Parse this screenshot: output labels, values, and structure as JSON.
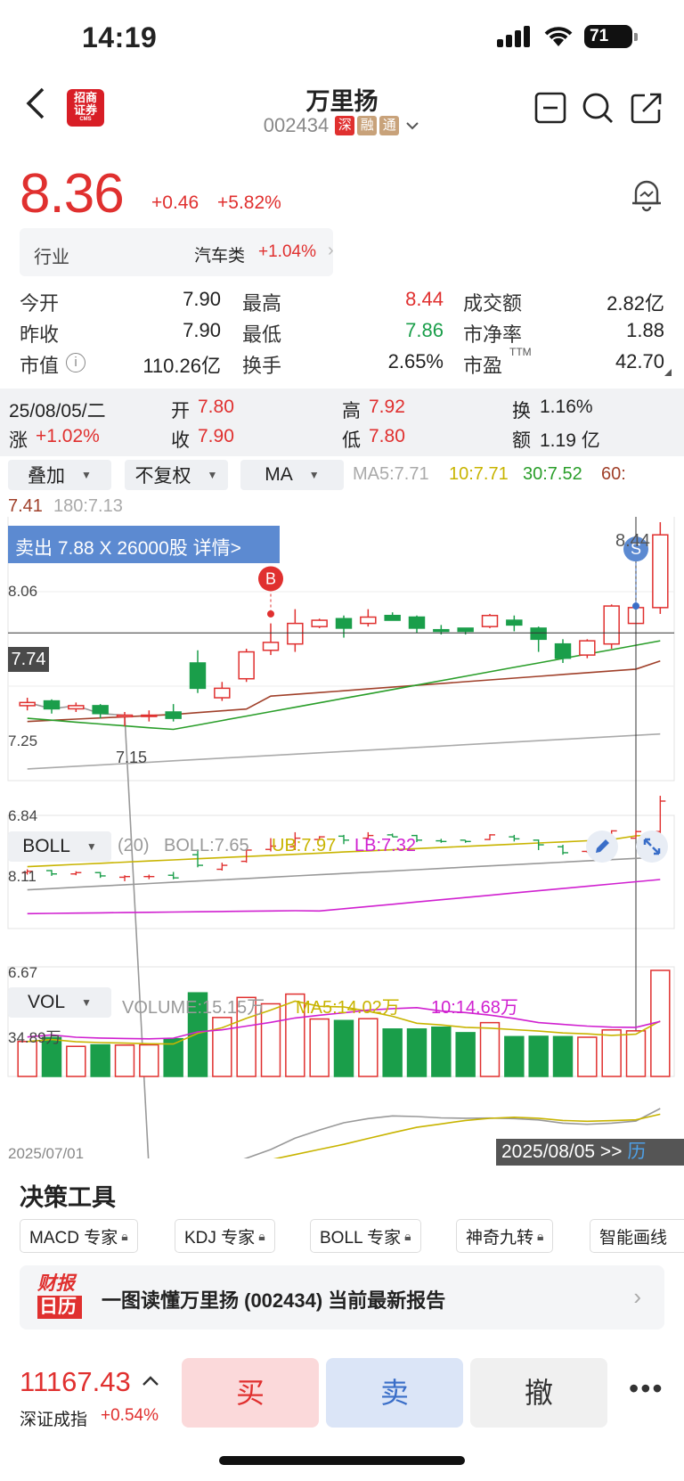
{
  "status_bar": {
    "time": "14:19",
    "battery": "71"
  },
  "header": {
    "title": "万里扬",
    "code": "002434",
    "tags": [
      {
        "text": "深",
        "color": "#e0302f"
      },
      {
        "text": "融",
        "color": "#c8a27a"
      },
      {
        "text": "通",
        "color": "#c8a27a"
      }
    ],
    "broker_logo": "招商证券",
    "broker_logo_sub": "CMS"
  },
  "quote": {
    "price": "8.36",
    "change": "+0.46",
    "change_pct": "+5.82%",
    "industry_label": "行业",
    "industry_name": "汽车类",
    "industry_pct": "+1.04%"
  },
  "stats": [
    {
      "label": "今开",
      "value": "7.90",
      "color": "#222"
    },
    {
      "label": "最高",
      "value": "8.44",
      "color": "#e0302f"
    },
    {
      "label": "成交额",
      "value": "2.82亿",
      "color": "#222"
    },
    {
      "label": "昨收",
      "value": "7.90",
      "color": "#222"
    },
    {
      "label": "最低",
      "value": "7.86",
      "color": "#1a9e4a"
    },
    {
      "label": "市净率",
      "value": "1.88",
      "color": "#222"
    },
    {
      "label": "市值",
      "value": "110.26亿",
      "color": "#222"
    },
    {
      "label": "换手",
      "value": "2.65%",
      "color": "#222"
    },
    {
      "label": "市盈",
      "value": "42.70",
      "color": "#222"
    }
  ],
  "stats_ttm": "TTM",
  "day_info": {
    "date": "25/08/05/二",
    "open_label": "开",
    "open": "7.80",
    "high_label": "高",
    "high": "7.92",
    "turnover_label": "换",
    "turnover": "1.16%",
    "rise_label": "涨",
    "rise": "+1.02%",
    "close_label": "收",
    "close": "7.90",
    "low_label": "低",
    "low": "7.80",
    "amount_label": "额",
    "amount": "1.19 亿"
  },
  "controls": {
    "overlay": "叠加",
    "adjust": "不复权",
    "indicator": "MA"
  },
  "ma_legend": {
    "ma5": "MA5:7.71",
    "ma10": "10:7.71",
    "ma30": "30:7.52",
    "ma60_label": "60:",
    "ma60": "7.41",
    "ma180": "180:7.13"
  },
  "trade_banner": "卖出 7.88 X 26000股  详情>",
  "price_axis": {
    "top": "8.44",
    "upper": "8.06",
    "mid": "7.74",
    "low_mark": "7.15",
    "lower": "7.25",
    "bottom": "6.84"
  },
  "markers": {
    "buy": "B",
    "sell": "S"
  },
  "chart_data": {
    "type": "candlestick",
    "dates_range": [
      "2025/07/01",
      "2025/08/05"
    ],
    "candles": [
      {
        "o": 7.28,
        "c": 7.3,
        "h": 7.33,
        "l": 7.25
      },
      {
        "o": 7.31,
        "c": 7.26,
        "h": 7.32,
        "l": 7.23
      },
      {
        "o": 7.26,
        "c": 7.28,
        "h": 7.3,
        "l": 7.24
      },
      {
        "o": 7.28,
        "c": 7.23,
        "h": 7.29,
        "l": 7.2
      },
      {
        "o": 7.21,
        "c": 7.22,
        "h": 7.24,
        "l": 7.15
      },
      {
        "o": 7.22,
        "c": 7.22,
        "h": 7.25,
        "l": 7.18
      },
      {
        "o": 7.24,
        "c": 7.2,
        "h": 7.29,
        "l": 7.18
      },
      {
        "o": 7.55,
        "c": 7.39,
        "h": 7.63,
        "l": 7.36
      },
      {
        "o": 7.33,
        "c": 7.39,
        "h": 7.43,
        "l": 7.31
      },
      {
        "o": 7.45,
        "c": 7.62,
        "h": 7.64,
        "l": 7.43
      },
      {
        "o": 7.63,
        "c": 7.68,
        "h": 7.8,
        "l": 7.6
      },
      {
        "o": 7.67,
        "c": 7.8,
        "h": 7.89,
        "l": 7.62
      },
      {
        "o": 7.78,
        "c": 7.82,
        "h": 7.83,
        "l": 7.77
      },
      {
        "o": 7.83,
        "c": 7.77,
        "h": 7.85,
        "l": 7.71
      },
      {
        "o": 7.8,
        "c": 7.84,
        "h": 7.89,
        "l": 7.78
      },
      {
        "o": 7.85,
        "c": 7.82,
        "h": 7.87,
        "l": 7.82
      },
      {
        "o": 7.84,
        "c": 7.77,
        "h": 7.85,
        "l": 7.74
      },
      {
        "o": 7.76,
        "c": 7.75,
        "h": 7.79,
        "l": 7.73
      },
      {
        "o": 7.77,
        "c": 7.75,
        "h": 7.77,
        "l": 7.73
      },
      {
        "o": 7.78,
        "c": 7.85,
        "h": 7.86,
        "l": 7.77
      },
      {
        "o": 7.82,
        "c": 7.79,
        "h": 7.85,
        "l": 7.75
      },
      {
        "o": 7.77,
        "c": 7.7,
        "h": 7.78,
        "l": 7.62
      },
      {
        "o": 7.67,
        "c": 7.58,
        "h": 7.7,
        "l": 7.55
      },
      {
        "o": 7.6,
        "c": 7.69,
        "h": 7.7,
        "l": 7.58
      },
      {
        "o": 7.67,
        "c": 7.91,
        "h": 7.92,
        "l": 7.64
      },
      {
        "o": 7.8,
        "c": 7.9,
        "h": 7.92,
        "l": 7.8
      },
      {
        "o": 7.9,
        "c": 8.36,
        "h": 8.44,
        "l": 7.86
      }
    ],
    "boll": {
      "label": "BOLL",
      "period": "(20)",
      "mid": "BOLL:7.65",
      "ub": "UB:7.97",
      "lb": "LB:7.32",
      "top": "8.11",
      "bottom": "6.67"
    },
    "volume": {
      "label": "VOL",
      "value": "VOLUME:15.15万",
      "ma5": "MA5:14.02万",
      "ma10": "10:14.68万",
      "max": "34.89万",
      "bars": [
        11.5,
        12.8,
        9.9,
        10.4,
        10.3,
        10.4,
        12.4,
        27.5,
        19.4,
        26.0,
        23.9,
        27.1,
        18.9,
        18.4,
        19.0,
        15.6,
        15.6,
        16.2,
        14.4,
        17.7,
        13.1,
        13.2,
        13.1,
        12.9,
        15.3,
        15.0,
        34.9
      ]
    }
  },
  "date_left": "2025/07/01",
  "date_right": "2025/08/05 >>",
  "date_right_tag": "历",
  "tools": {
    "title": "决策工具",
    "chips": [
      "MACD 专家",
      "KDJ 专家",
      "BOLL 专家",
      "神奇九转",
      "智能画线"
    ]
  },
  "report": {
    "logo_top": "财报",
    "logo_bottom": "日历",
    "text": "一图读懂万里扬 (002434) 当前最新报告"
  },
  "bottom": {
    "index_value": "11167.43",
    "index_name": "深证成指",
    "index_pct": "+0.54%",
    "buy": "买",
    "sell": "卖",
    "cancel": "撤",
    "more": "•••"
  }
}
